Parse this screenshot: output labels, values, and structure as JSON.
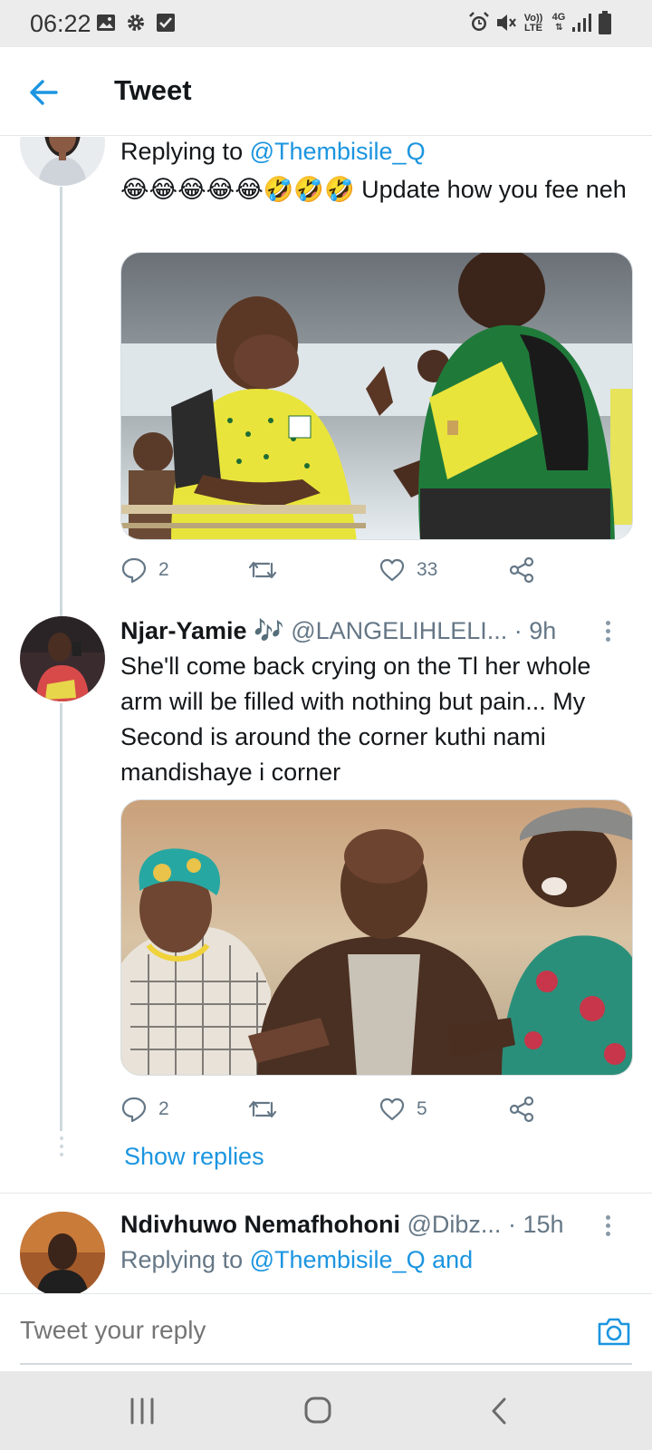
{
  "status_bar": {
    "time": "06:22",
    "left_icons": [
      "image-icon",
      "gear-icon",
      "checkbox-icon"
    ],
    "right_icons": [
      "alarm-icon",
      "mute-icon",
      "volte-icon",
      "network-4g-icon",
      "signal-icon",
      "battery-icon"
    ],
    "volte_top": "Vo))",
    "volte_bottom": "LTE",
    "network_label": "4G"
  },
  "header": {
    "title": "Tweet",
    "back_icon": "arrow-left-icon"
  },
  "tweets": [
    {
      "replying_prefix": "Replying to ",
      "replying_handle": "@Thembisile_Q",
      "emojis": "😂😂😂😂😂🤣🤣🤣",
      "text": " Update how you fee neh",
      "media_desc": "photo",
      "counts": {
        "replies": "2",
        "retweets": "",
        "likes": "33"
      }
    },
    {
      "name": "Njar-Yamie",
      "name_emoji": "🎶",
      "handle": "@LANGELIHLELI...",
      "time": "· 9h",
      "text": "She'll come back crying on the Tl her whole arm will be filled with nothing but pain... My Second is around the corner kuthi nami mandishaye i corner",
      "counts": {
        "replies": "2",
        "retweets": "",
        "likes": "5"
      },
      "show_replies": "Show replies"
    },
    {
      "name": "Ndivhuwo Nemafhohoni",
      "handle": "@Dibz...",
      "time": "· 15h",
      "replying_prefix": "Replying to ",
      "replying_handle": "@Thembisile_Q and"
    }
  ],
  "composer": {
    "placeholder": "Tweet your reply",
    "camera_icon": "camera-icon"
  },
  "nav_bar": {
    "buttons": [
      "recents-icon",
      "home-icon",
      "back-icon"
    ]
  },
  "colors": {
    "accent": "#1b95e0",
    "text": "#14171a",
    "secondary": "#657786",
    "border": "#e3e6e8",
    "status_bar": "#ececec",
    "nav_bar": "#e8e8e8"
  }
}
